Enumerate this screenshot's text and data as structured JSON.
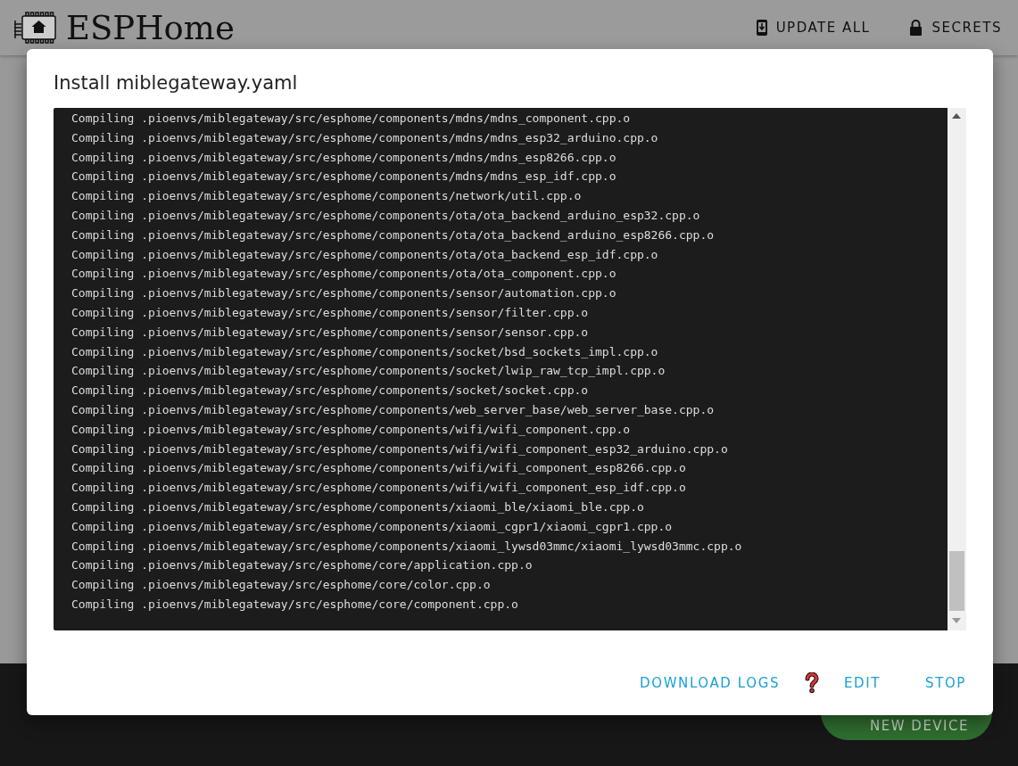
{
  "app_bar": {
    "title": "ESPHome",
    "actions": [
      {
        "kind": "update",
        "label": "UPDATE ALL"
      },
      {
        "kind": "secrets",
        "label": "SECRETS"
      }
    ]
  },
  "fab": {
    "label": "NEW DEVICE"
  },
  "dialog": {
    "title": "Install miblegateway.yaml",
    "log_lines": [
      "Compiling .pioenvs/miblegateway/src/esphome/components/mdns/mdns_component.cpp.o",
      "Compiling .pioenvs/miblegateway/src/esphome/components/mdns/mdns_esp32_arduino.cpp.o",
      "Compiling .pioenvs/miblegateway/src/esphome/components/mdns/mdns_esp8266.cpp.o",
      "Compiling .pioenvs/miblegateway/src/esphome/components/mdns/mdns_esp_idf.cpp.o",
      "Compiling .pioenvs/miblegateway/src/esphome/components/network/util.cpp.o",
      "Compiling .pioenvs/miblegateway/src/esphome/components/ota/ota_backend_arduino_esp32.cpp.o",
      "Compiling .pioenvs/miblegateway/src/esphome/components/ota/ota_backend_arduino_esp8266.cpp.o",
      "Compiling .pioenvs/miblegateway/src/esphome/components/ota/ota_backend_esp_idf.cpp.o",
      "Compiling .pioenvs/miblegateway/src/esphome/components/ota/ota_component.cpp.o",
      "Compiling .pioenvs/miblegateway/src/esphome/components/sensor/automation.cpp.o",
      "Compiling .pioenvs/miblegateway/src/esphome/components/sensor/filter.cpp.o",
      "Compiling .pioenvs/miblegateway/src/esphome/components/sensor/sensor.cpp.o",
      "Compiling .pioenvs/miblegateway/src/esphome/components/socket/bsd_sockets_impl.cpp.o",
      "Compiling .pioenvs/miblegateway/src/esphome/components/socket/lwip_raw_tcp_impl.cpp.o",
      "Compiling .pioenvs/miblegateway/src/esphome/components/socket/socket.cpp.o",
      "Compiling .pioenvs/miblegateway/src/esphome/components/web_server_base/web_server_base.cpp.o",
      "Compiling .pioenvs/miblegateway/src/esphome/components/wifi/wifi_component.cpp.o",
      "Compiling .pioenvs/miblegateway/src/esphome/components/wifi/wifi_component_esp32_arduino.cpp.o",
      "Compiling .pioenvs/miblegateway/src/esphome/components/wifi/wifi_component_esp8266.cpp.o",
      "Compiling .pioenvs/miblegateway/src/esphome/components/wifi/wifi_component_esp_idf.cpp.o",
      "Compiling .pioenvs/miblegateway/src/esphome/components/xiaomi_ble/xiaomi_ble.cpp.o",
      "Compiling .pioenvs/miblegateway/src/esphome/components/xiaomi_cgpr1/xiaomi_cgpr1.cpp.o",
      "Compiling .pioenvs/miblegateway/src/esphome/components/xiaomi_lywsd03mmc/xiaomi_lywsd03mmc.cpp.o",
      "Compiling .pioenvs/miblegateway/src/esphome/core/application.cpp.o",
      "Compiling .pioenvs/miblegateway/src/esphome/core/color.cpp.o",
      "Compiling .pioenvs/miblegateway/src/esphome/core/component.cpp.o"
    ],
    "actions": [
      {
        "kind": "button",
        "label": "DOWNLOAD LOGS"
      },
      {
        "kind": "help"
      },
      {
        "kind": "button",
        "label": "EDIT"
      },
      {
        "kind": "button",
        "label": "STOP"
      }
    ]
  }
}
